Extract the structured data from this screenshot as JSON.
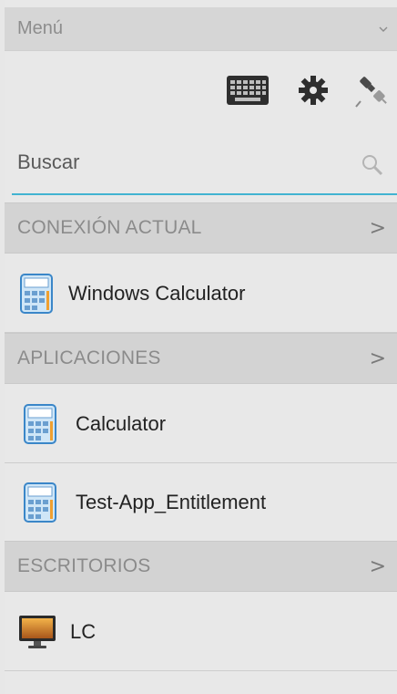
{
  "menu": {
    "title": "Menú"
  },
  "toolbar": {
    "icons": [
      "keyboard-icon",
      "gear-icon",
      "plug-icon"
    ]
  },
  "search": {
    "placeholder": "Buscar"
  },
  "sections": {
    "current": {
      "label": "CONEXIÓN ACTUAL",
      "chevron": ">"
    },
    "apps": {
      "label": "APLICACIONES",
      "chevron": ">"
    },
    "desktops": {
      "label": "ESCRITORIOS",
      "chevron": ">"
    }
  },
  "current_items": [
    {
      "label": "Windows Calculator",
      "icon": "calculator-icon"
    }
  ],
  "app_items": [
    {
      "label": "Calculator",
      "icon": "calculator-icon"
    },
    {
      "label": "Test-App_Entitlement",
      "icon": "calculator-icon"
    }
  ],
  "desktop_items": [
    {
      "label": "LC",
      "icon": "desktop-monitor-icon"
    }
  ],
  "colors": {
    "accent": "#42b3d1",
    "header_bg": "#d6d6d6",
    "section_bg": "#d3d3d3",
    "background": "#e8e8e8"
  }
}
